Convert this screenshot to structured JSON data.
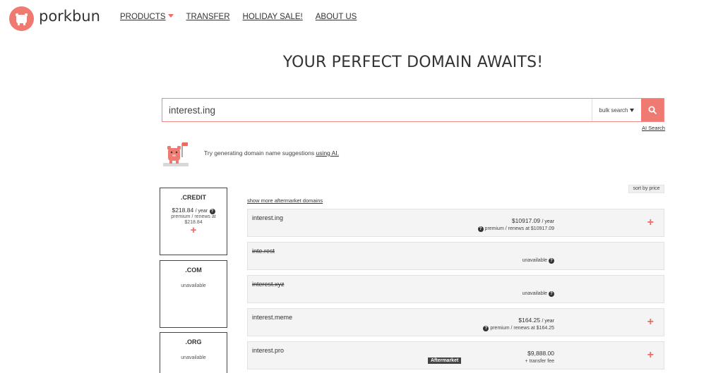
{
  "brand": {
    "name": "porkbun",
    "color": "#ef7a72"
  },
  "nav": [
    {
      "label": "PRODUCTS"
    },
    {
      "label": "TRANSFER"
    },
    {
      "label": "HOLIDAY SALE!"
    },
    {
      "label": "ABOUT US"
    }
  ],
  "hero": {
    "title": "YOUR PERFECT DOMAIN AWAITS!"
  },
  "search": {
    "value": "interest.ing",
    "bulk_label": "bulk search",
    "ai_search_label": "AI Search"
  },
  "ai_suggestion": {
    "text": "Try generating domain name suggestions",
    "link": "using AI."
  },
  "tld_cards": [
    {
      "tld": ".CREDIT",
      "price": "$218.84",
      "per": "/ year",
      "sub": "premium / renews at $218.84"
    },
    {
      "tld": ".COM",
      "status": "unavailable"
    },
    {
      "tld": ".ORG",
      "status": "unavailable"
    }
  ],
  "results_toolbar": {
    "sort_label": "sort by price",
    "show_more_label": "show more aftermarket domains"
  },
  "results": [
    {
      "domain": "interest.ing",
      "price": "$10917.09",
      "per": "/ year",
      "sub": "premium / renews at $10917.09"
    },
    {
      "domain": "inte.rest",
      "status": "unavailable"
    },
    {
      "domain": "interest.xyz",
      "status": "unavailable"
    },
    {
      "domain": "interest.meme",
      "price": "$164.25",
      "per": "/ year",
      "sub": "premium / renews at $164.25"
    },
    {
      "domain": "interest.pro",
      "badge": "Aftermarket",
      "price": "$9,888.00",
      "sub": "+ transfer fee"
    }
  ]
}
